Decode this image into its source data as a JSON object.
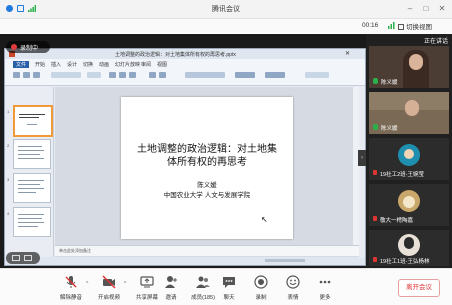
{
  "window": {
    "title": "腾讯会议"
  },
  "meeting": {
    "elapsed": "00:16",
    "view_toggle_label": "切换视图",
    "recording_label": "录制中",
    "speaking_label": "正在讲话"
  },
  "ppt": {
    "doc_title": "土地调整的政治逻辑：对土地集体所有权的再思考.pptx",
    "ribbon_tabs": [
      "文件",
      "开始",
      "插入",
      "设计",
      "切换",
      "动画",
      "幻灯片放映",
      "审阅",
      "视图"
    ],
    "slide": {
      "title_line1": "土地调整的政治逻辑：对土地集",
      "title_line2": "体所有权的再思考",
      "author": "陈义媛",
      "affiliation": "中国农业大学 人文与发展学院"
    },
    "notes_placeholder": "单击此处添加备注",
    "thumb_numbers": [
      "1",
      "2",
      "3",
      "4"
    ]
  },
  "participants": [
    {
      "name": "陈义媛"
    },
    {
      "name": "陈义媛"
    },
    {
      "name": "19社工2班-王婉莹"
    },
    {
      "name": "敬大一樗陶嘉"
    },
    {
      "name": "19社工1班-王弘杨林"
    }
  ],
  "toolbar": {
    "items": [
      {
        "label": "解除静音",
        "icon": "mic-muted-icon"
      },
      {
        "label": "开启视频",
        "icon": "camera-off-icon"
      },
      {
        "label": "共享屏幕",
        "icon": "share-screen-icon"
      },
      {
        "label": "邀请",
        "icon": "invite-icon"
      },
      {
        "label": "成员(185)",
        "icon": "members-icon"
      },
      {
        "label": "聊天",
        "icon": "chat-icon"
      },
      {
        "label": "录制",
        "icon": "record-icon"
      },
      {
        "label": "表情",
        "icon": "emoji-icon"
      },
      {
        "label": "更多",
        "icon": "more-icon"
      }
    ],
    "leave_label": "离开会议"
  },
  "colors": {
    "accent": "#1f7ae0",
    "record": "#e23b3b",
    "leave": "#d33333"
  }
}
